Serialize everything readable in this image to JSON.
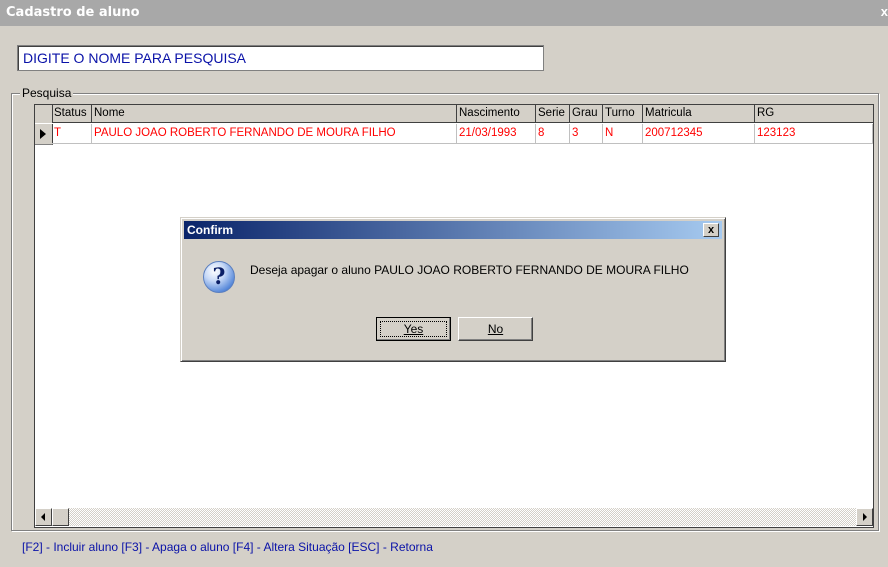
{
  "window": {
    "title": "Cadastro de aluno",
    "close_glyph": "x"
  },
  "search": {
    "value": "DIGITE O NOME PARA PESQUISA"
  },
  "group": {
    "label": "Pesquisa"
  },
  "grid": {
    "columns": [
      "Status",
      "Nome",
      "Nascimento",
      "Serie",
      "Grau",
      "Turno",
      "Matricula",
      "RG"
    ],
    "rows": [
      [
        "T",
        "PAULO JOAO ROBERTO FERNANDO DE MOURA FILHO",
        "21/03/1993",
        "8",
        "3",
        "N",
        "200712345",
        "123123"
      ]
    ],
    "row_color": "#ff0000"
  },
  "hint": "[F2] - Incluir aluno  [F3] - Apaga o aluno  [F4] - Altera Situação  [ESC] - Retorna",
  "dialog": {
    "title": "Confirm",
    "close_label": "x",
    "icon": "question-icon",
    "message": "Deseja apagar o aluno PAULO JOAO ROBERTO FERNANDO DE MOURA FILHO",
    "yes_label": "Yes",
    "no_label": "No"
  }
}
